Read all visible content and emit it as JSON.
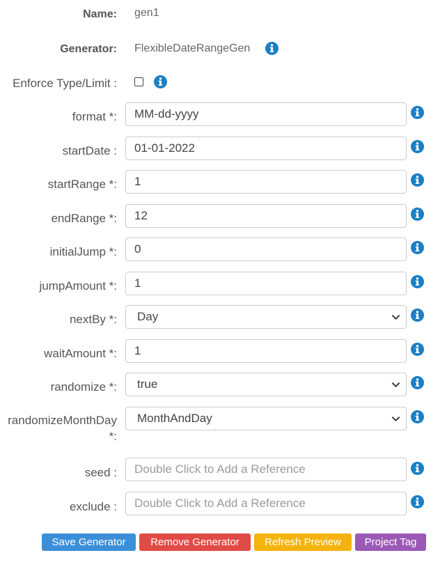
{
  "name": {
    "label": "Name:",
    "value": "gen1"
  },
  "generator": {
    "label": "Generator:",
    "value": "FlexibleDateRangeGen"
  },
  "enforce": {
    "label": "Enforce Type/Limit :",
    "checked": false
  },
  "fields": {
    "format": {
      "label": "format *:",
      "value": "MM-dd-yyyy"
    },
    "startDate": {
      "label": "startDate :",
      "value": "01-01-2022"
    },
    "startRange": {
      "label": "startRange *:",
      "value": "1"
    },
    "endRange": {
      "label": "endRange *:",
      "value": "12"
    },
    "initialJump": {
      "label": "initialJump *:",
      "value": "0"
    },
    "jumpAmount": {
      "label": "jumpAmount *:",
      "value": "1"
    },
    "nextBy": {
      "label": "nextBy *:",
      "value": "Day"
    },
    "waitAmount": {
      "label": "waitAmount *:",
      "value": "1"
    },
    "randomize": {
      "label": "randomize *:",
      "value": "true"
    },
    "randomizeMonthDay": {
      "label": "randomizeMonthDay *:",
      "value": "MonthAndDay"
    },
    "seed": {
      "label": "seed :",
      "placeholder": "Double Click to Add a Reference"
    },
    "exclude": {
      "label": "exclude :",
      "placeholder": "Double Click to Add a Reference"
    }
  },
  "buttons": {
    "save": "Save Generator",
    "remove": "Remove Generator",
    "refresh": "Refresh Preview",
    "project_tag": "Project Tag"
  },
  "colors": {
    "info_icon": "#1a7fc4",
    "save": "#3b8fd8",
    "remove": "#e14b45",
    "refresh": "#f5b30d",
    "project_tag": "#9b59b6"
  },
  "icons": {
    "info": "info-circle-icon",
    "select_arrow": "chevron-down-icon"
  }
}
